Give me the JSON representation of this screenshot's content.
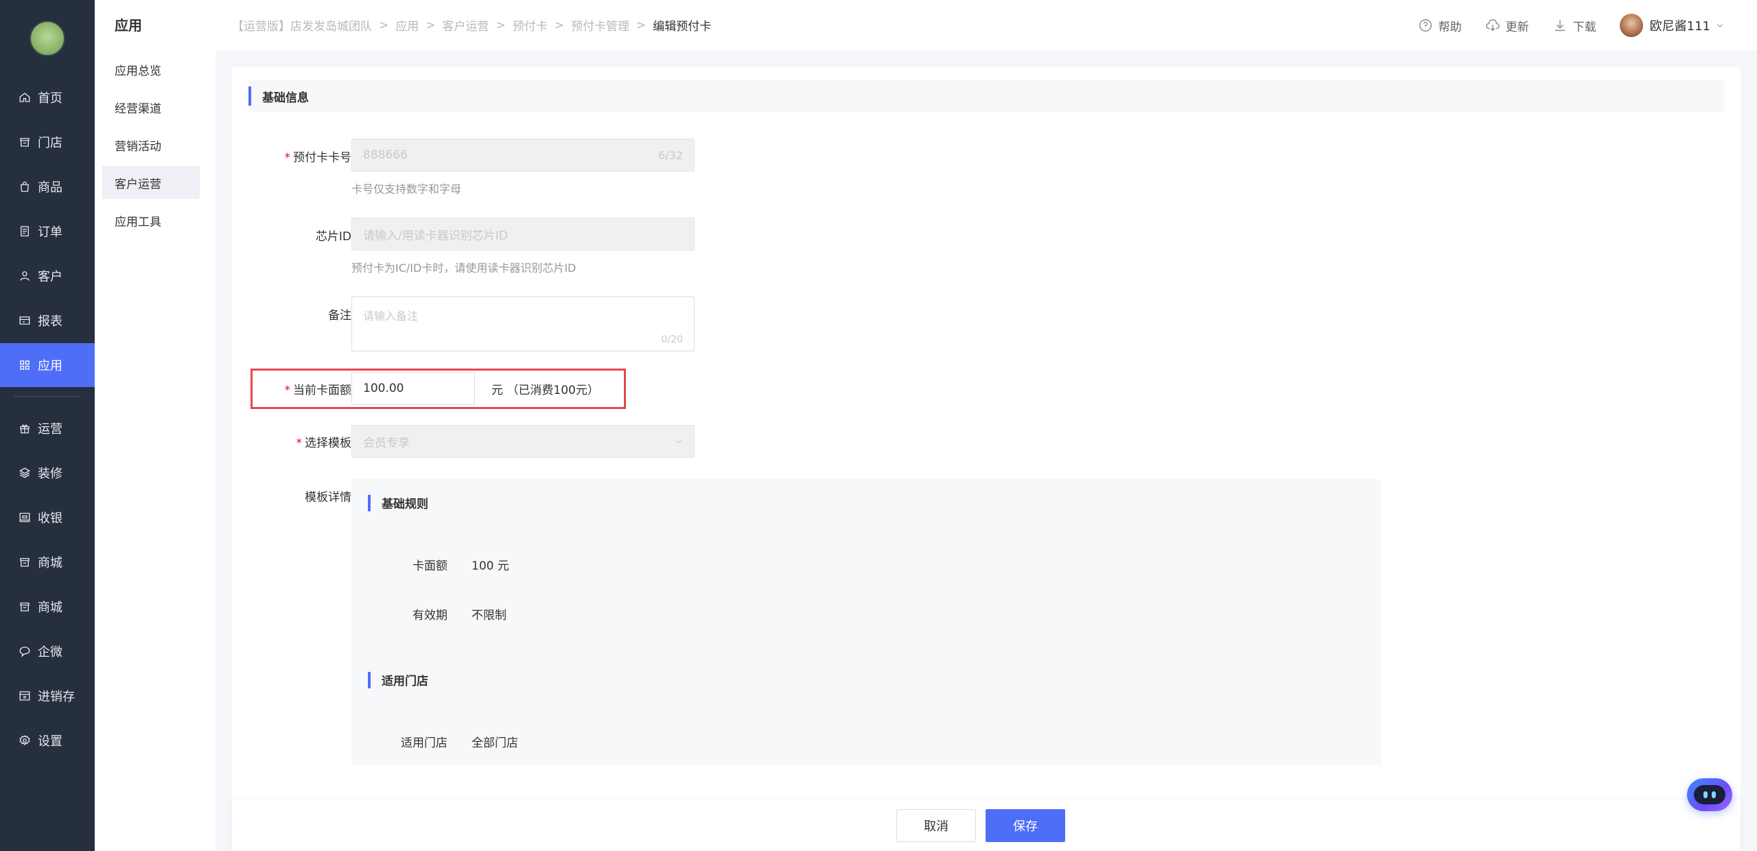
{
  "nav": {
    "items": [
      {
        "label": "首页",
        "icon": "home-icon"
      },
      {
        "label": "门店",
        "icon": "store-icon"
      },
      {
        "label": "商品",
        "icon": "bag-icon"
      },
      {
        "label": "订单",
        "icon": "order-icon"
      },
      {
        "label": "客户",
        "icon": "user-icon"
      },
      {
        "label": "报表",
        "icon": "report-icon"
      },
      {
        "label": "应用",
        "icon": "apps-icon",
        "active": true
      },
      {
        "label": "运营",
        "icon": "gift-icon"
      },
      {
        "label": "装修",
        "icon": "layers-icon"
      },
      {
        "label": "收银",
        "icon": "cashier-icon"
      },
      {
        "label": "商城",
        "icon": "mall-icon"
      },
      {
        "label": "商城",
        "icon": "mall-icon"
      },
      {
        "label": "企微",
        "icon": "chat-icon"
      },
      {
        "label": "进销存",
        "icon": "inventory-icon"
      },
      {
        "label": "设置",
        "icon": "settings-icon"
      }
    ]
  },
  "subnav": {
    "title": "应用",
    "items": [
      "应用总览",
      "经营渠道",
      "营销活动",
      "客户运营",
      "应用工具"
    ],
    "active_index": 3
  },
  "breadcrumb": [
    "【运营版】店发发岛城团队",
    "应用",
    "客户运营",
    "预付卡",
    "预付卡管理",
    "编辑预付卡"
  ],
  "top_actions": {
    "help": "帮助",
    "update": "更新",
    "download": "下载",
    "username": "欧尼酱111"
  },
  "form": {
    "section_title": "基础信息",
    "card_no_label": "预付卡卡号",
    "card_no_value": "888666",
    "card_no_counter": "6/32",
    "card_no_hint": "卡号仅支持数字和字母",
    "chip_label": "芯片ID",
    "chip_placeholder": "请输入/用读卡器识别芯片ID",
    "chip_hint": "预付卡为IC/ID卡时，请使用读卡器识别芯片ID",
    "remark_label": "备注",
    "remark_placeholder": "请输入备注",
    "remark_counter": "0/20",
    "amount_label": "当前卡面额",
    "amount_value": "100.00",
    "amount_suffix": "元 （已消费100元）",
    "template_label": "选择模板",
    "template_value": "会员专享",
    "detail_label": "模板详情"
  },
  "detail": {
    "rules_title": "基础规则",
    "face_label": "卡面额",
    "face_value": "100 元",
    "validity_label": "有效期",
    "validity_value": "不限制",
    "stores_title": "适用门店",
    "stores_label": "适用门店",
    "stores_value": "全部门店"
  },
  "footer": {
    "cancel": "取消",
    "save": "保存"
  },
  "colors": {
    "primary": "#4f6ef7",
    "nav_bg": "#262f3e",
    "highlight": "#e5484d",
    "required": "#ee0a24"
  }
}
